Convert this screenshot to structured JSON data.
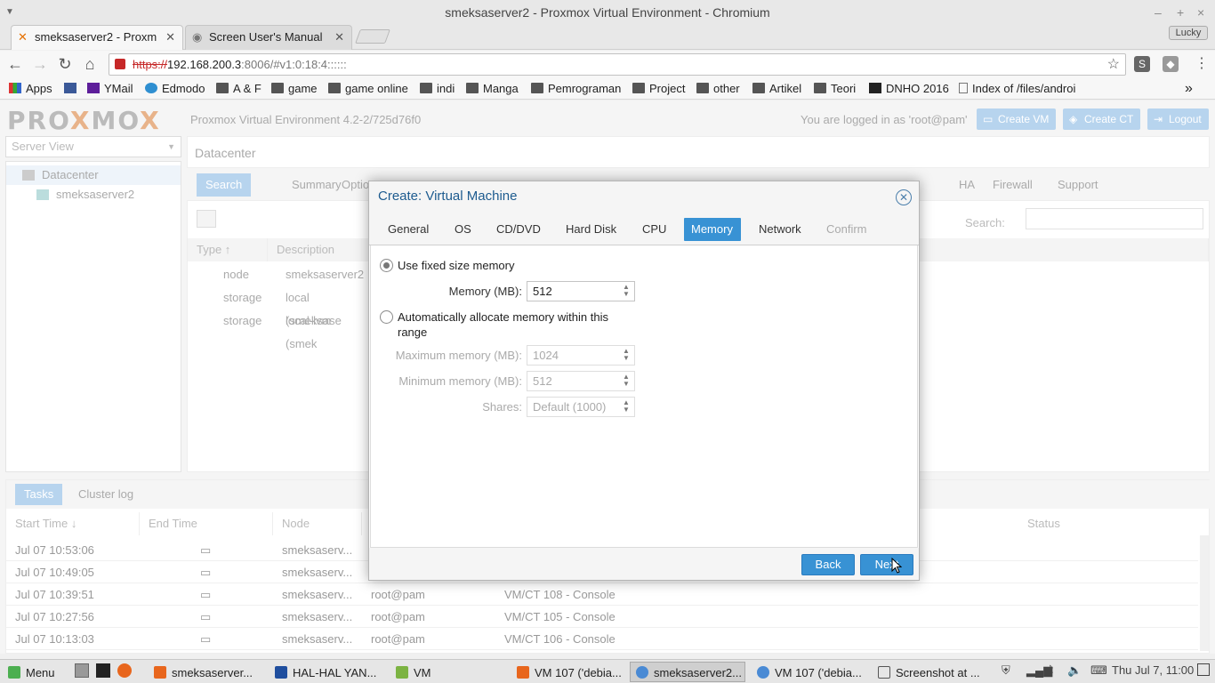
{
  "window": {
    "title": "smeksaserver2 - Proxmox Virtual Environment - Chromium",
    "minimize": "–",
    "maximize": "+",
    "close": "×"
  },
  "tabs": [
    {
      "label": "smeksaserver2 - Proxm",
      "active": true
    },
    {
      "label": "Screen User's Manual",
      "active": false
    }
  ],
  "profile": "Lucky",
  "address": {
    "scheme": "https://",
    "host": "192.168.200.3",
    "path": ":8006/#v1:0:18:4::::::"
  },
  "bookmarks": [
    "Apps",
    "YMail",
    "Edmodo",
    "A & F",
    "game",
    "game online",
    "indi",
    "Manga",
    "Pemrograman",
    "Project",
    "other",
    "Artikel",
    "Teori",
    "DNHO 2016",
    "Index of /files/androi"
  ],
  "bookmarks_more": "»",
  "pve": {
    "logo": "PROXMOX",
    "version": "Proxmox Virtual Environment 4.2-2/725d76f0",
    "logged_in": "You are logged in as 'root@pam'",
    "create_vm": "Create VM",
    "create_ct": "Create CT",
    "logout": "Logout",
    "server_view": "Server View",
    "tree": [
      "Datacenter",
      "smeksaserver2"
    ],
    "main_title": "Datacenter",
    "main_tabs": [
      "Search",
      "Summary",
      "Optio",
      "HA",
      "Firewall",
      "Support"
    ],
    "search_label": "Search:",
    "grid_headers": [
      "Type",
      "Description"
    ],
    "grid_rows": [
      {
        "type": "node",
        "desc": "smeksaserver2"
      },
      {
        "type": "storage",
        "desc": "local (smeksase"
      },
      {
        "type": "storage",
        "desc": "local-lvm (smek"
      }
    ],
    "task_tabs": [
      "Tasks",
      "Cluster log"
    ],
    "task_headers": [
      "Start Time",
      "End Time",
      "Node",
      "Status"
    ],
    "tasks": [
      {
        "start": "Jul 07 10:53:06",
        "node": "smeksaserv...",
        "user": "",
        "desc": ""
      },
      {
        "start": "Jul 07 10:49:05",
        "node": "smeksaserv...",
        "user": "",
        "desc": ""
      },
      {
        "start": "Jul 07 10:39:51",
        "node": "smeksaserv...",
        "user": "root@pam",
        "desc": "VM/CT 108 - Console"
      },
      {
        "start": "Jul 07 10:27:56",
        "node": "smeksaserv...",
        "user": "root@pam",
        "desc": "VM/CT 105 - Console"
      },
      {
        "start": "Jul 07 10:13:03",
        "node": "smeksaserv...",
        "user": "root@pam",
        "desc": "VM/CT 106 - Console"
      }
    ]
  },
  "wizard": {
    "title": "Create: Virtual Machine",
    "tabs": [
      "General",
      "OS",
      "CD/DVD",
      "Hard Disk",
      "CPU",
      "Memory",
      "Network",
      "Confirm"
    ],
    "active_tab": "Memory",
    "fixed_label": "Use fixed size memory",
    "fixed_selected": true,
    "memory_label": "Memory (MB):",
    "memory_value": "512",
    "auto_label_1": "Automatically allocate memory within this",
    "auto_label_2": "range",
    "max_label": "Maximum memory (MB):",
    "max_value": "1024",
    "min_label": "Minimum memory (MB):",
    "min_value": "512",
    "shares_label": "Shares:",
    "shares_value": "Default (1000)",
    "back": "Back",
    "next": "Next"
  },
  "taskbar": {
    "menu": "Menu",
    "items": [
      "smeksaserver...",
      "HAL-HAL YAN...",
      "VM",
      "VM 107 ('debia...",
      "smeksaserver2...",
      "VM 107 ('debia...",
      "Screenshot at ..."
    ],
    "clock": "Thu Jul  7, 11:00"
  }
}
